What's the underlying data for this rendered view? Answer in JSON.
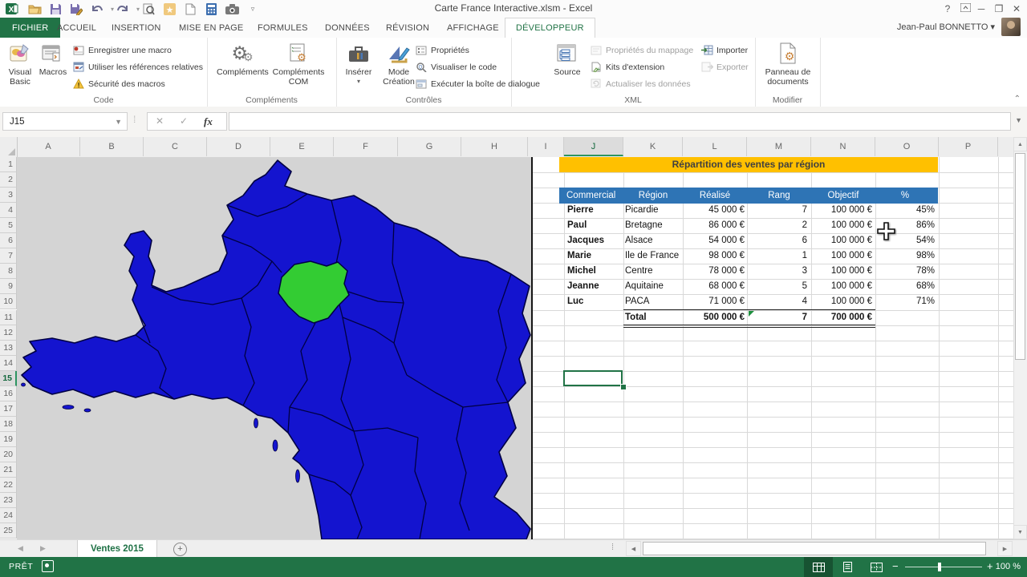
{
  "title_bar": {
    "title": "Carte France Interactive.xlsm - Excel",
    "help": "?",
    "minimize": "─",
    "restore": "❐",
    "close": "✕"
  },
  "qat": {
    "icons": [
      "excel-logo",
      "open",
      "save",
      "save-as",
      "undo",
      "redo",
      "print-preview",
      "favorites",
      "new-document",
      "calculator",
      "camera",
      "customize-dropdown"
    ]
  },
  "account": {
    "name": "Jean-Paul BONNETTO"
  },
  "ribbon": {
    "tabs": [
      "FICHIER",
      "ACCUEIL",
      "INSERTION",
      "MISE EN PAGE",
      "FORMULES",
      "DONNÉES",
      "RÉVISION",
      "AFFICHAGE",
      "DÉVELOPPEUR"
    ],
    "active_tab": "DÉVELOPPEUR",
    "groups": [
      {
        "label": "Code",
        "buttons": {
          "visual_basic_1": "Visual",
          "visual_basic_2": "Basic",
          "macros": "Macros",
          "record_macro": "Enregistrer une macro",
          "relative_refs": "Utiliser les références relatives",
          "macro_security": "Sécurité des macros"
        }
      },
      {
        "label": "Compléments",
        "buttons": {
          "addins": "Compléments",
          "com_addins_1": "Compléments",
          "com_addins_2": "COM"
        }
      },
      {
        "label": "Contrôles",
        "buttons": {
          "insert": "Insérer",
          "design_mode_1": "Mode",
          "design_mode_2": "Création",
          "properties": "Propriétés",
          "view_code": "Visualiser le code",
          "run_dialog": "Exécuter la boîte de dialogue"
        }
      },
      {
        "label": "XML",
        "buttons": {
          "source": "Source",
          "map_properties": "Propriétés du mappage",
          "expansion_packs": "Kits d'extension",
          "refresh_data": "Actualiser les données",
          "import": "Importer",
          "export": "Exporter"
        }
      },
      {
        "label": "Modifier",
        "buttons": {
          "document_panel_1": "Panneau de",
          "document_panel_2": "documents"
        }
      }
    ]
  },
  "formula_bar": {
    "name_box": "J15",
    "formula": "",
    "cancel": "✕",
    "enter": "✓",
    "fx": "fx"
  },
  "grid": {
    "columns": [
      "A",
      "B",
      "C",
      "D",
      "E",
      "F",
      "G",
      "H",
      "I",
      "J",
      "K",
      "L",
      "M",
      "N",
      "O",
      "P"
    ],
    "selected_column": "J",
    "row_count": 25,
    "selected_row": 15,
    "selected_cell": "J15"
  },
  "map": {
    "background": "#d4d4d4",
    "region_fill": "#1414cf",
    "region_border": "#000042",
    "highlight_fill": "#33cc33"
  },
  "table": {
    "title": "Répartition des ventes par région",
    "headers": [
      "Commercial",
      "Région",
      "Réalisé",
      "Rang",
      "Objectif",
      "%"
    ],
    "rows": [
      {
        "commercial": "Pierre",
        "region": "Picardie",
        "realise": "45 000 €",
        "rang": "7",
        "objectif": "100 000 €",
        "pct": "45%"
      },
      {
        "commercial": "Paul",
        "region": "Bretagne",
        "realise": "86 000 €",
        "rang": "2",
        "objectif": "100 000 €",
        "pct": "86%"
      },
      {
        "commercial": "Jacques",
        "region": "Alsace",
        "realise": "54 000 €",
        "rang": "6",
        "objectif": "100 000 €",
        "pct": "54%"
      },
      {
        "commercial": "Marie",
        "region": "Ile de France",
        "realise": "98 000 €",
        "rang": "1",
        "objectif": "100 000 €",
        "pct": "98%"
      },
      {
        "commercial": "Michel",
        "region": "Centre",
        "realise": "78 000 €",
        "rang": "3",
        "objectif": "100 000 €",
        "pct": "78%"
      },
      {
        "commercial": "Jeanne",
        "region": "Aquitaine",
        "realise": "68 000 €",
        "rang": "5",
        "objectif": "100 000 €",
        "pct": "68%"
      },
      {
        "commercial": "Luc",
        "region": "PACA",
        "realise": "71 000 €",
        "rang": "4",
        "objectif": "100 000 €",
        "pct": "71%"
      }
    ],
    "total": {
      "label": "Total",
      "realise": "500 000 €",
      "rang": "7",
      "objectif": "700 000 €"
    }
  },
  "sheet_tabs": {
    "tabs": [
      {
        "label": "Ventes 2015",
        "active": true
      }
    ]
  },
  "status_bar": {
    "mode": "PRÊT",
    "zoom_out": "−",
    "zoom_in": "+",
    "zoom_level": "100 %"
  }
}
